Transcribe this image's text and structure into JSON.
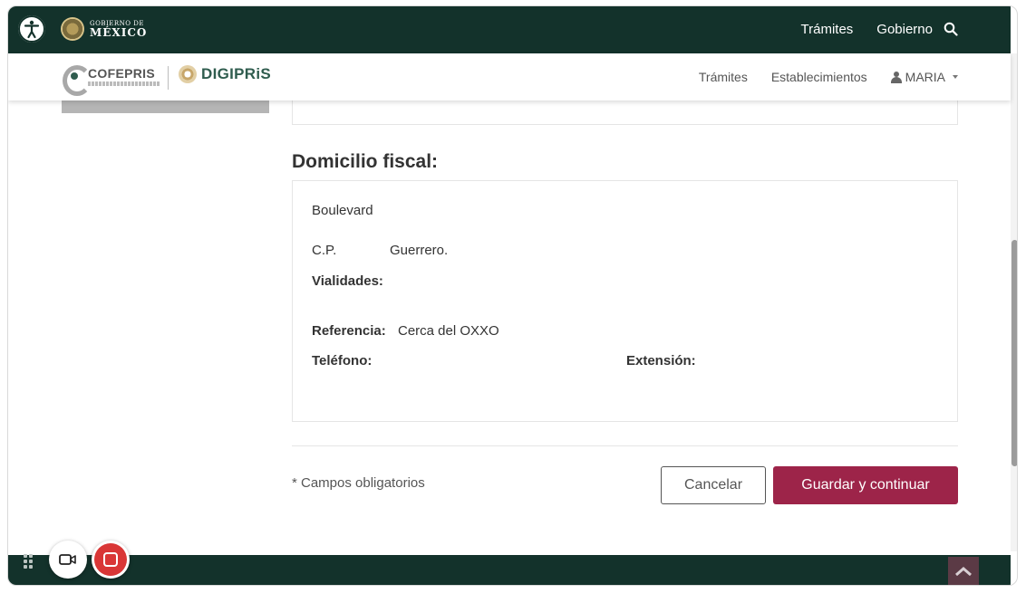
{
  "gov_header": {
    "logo_small": "GOBIERNO DE",
    "logo_big": "MÉXICO",
    "nav": [
      "Trámites",
      "Gobierno"
    ]
  },
  "sub_header": {
    "cofepris_name": "COFEPRIS",
    "digipris_name": "DIGIPRiS",
    "nav": [
      "Trámites",
      "Establecimientos"
    ],
    "user_name": "MARIA"
  },
  "section": {
    "title": "Domicilio fiscal:",
    "address_line": "Boulevard",
    "cp_label": "C.P.",
    "state": "Guerrero.",
    "vialidades_label": "Vialidades:",
    "referencia_label": "Referencia:",
    "referencia_value": "Cerca del OXXO",
    "telefono_label": "Teléfono:",
    "extension_label": "Extensión:"
  },
  "form_actions": {
    "required_note": "* Campos obligatorios",
    "cancel_label": "Cancelar",
    "save_label": "Guardar y continuar"
  },
  "colors": {
    "gov_green": "#13322b",
    "primary_button": "#9d2449",
    "record_red": "#d93636"
  },
  "icons": {
    "accessibility": "accessibility-icon",
    "search": "search-icon",
    "user": "user-icon",
    "caret": "caret-down-icon",
    "video": "video-camera-icon",
    "record": "stop-record-icon",
    "scroll_top": "chevron-up-icon",
    "drag": "drag-grip-icon"
  }
}
